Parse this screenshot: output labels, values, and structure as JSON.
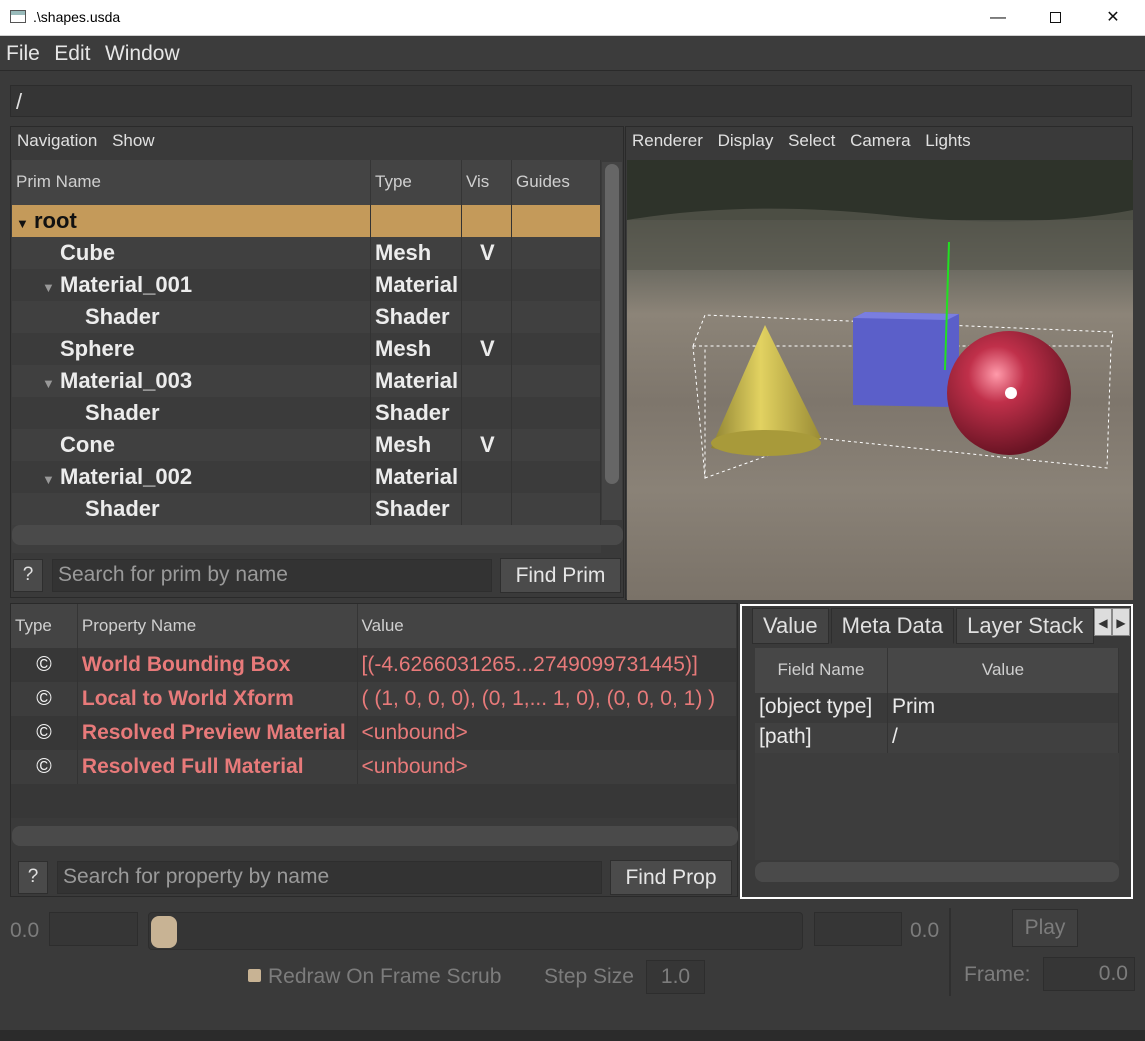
{
  "window": {
    "title": ".\\shapes.usda",
    "minimize": "—",
    "close": "✕"
  },
  "menu": [
    "File",
    "Edit",
    "Window"
  ],
  "path": "/",
  "navigation": {
    "menu": [
      "Navigation",
      "Show"
    ],
    "columns": [
      "Prim Name",
      "Type",
      "Vis",
      "Guides"
    ],
    "rows": [
      {
        "name": "root",
        "type": "",
        "vis": "",
        "depth": 0,
        "expander": "▼",
        "selected": true
      },
      {
        "name": "Cube",
        "type": "Mesh",
        "vis": "V",
        "depth": 1,
        "expander": ""
      },
      {
        "name": "Material_001",
        "type": "Material",
        "vis": "",
        "depth": 1,
        "expander": "▼"
      },
      {
        "name": "Shader",
        "type": "Shader",
        "vis": "",
        "depth": 2,
        "expander": ""
      },
      {
        "name": "Sphere",
        "type": "Mesh",
        "vis": "V",
        "depth": 1,
        "expander": ""
      },
      {
        "name": "Material_003",
        "type": "Material",
        "vis": "",
        "depth": 1,
        "expander": "▼"
      },
      {
        "name": "Shader",
        "type": "Shader",
        "vis": "",
        "depth": 2,
        "expander": ""
      },
      {
        "name": "Cone",
        "type": "Mesh",
        "vis": "V",
        "depth": 1,
        "expander": ""
      },
      {
        "name": "Material_002",
        "type": "Material",
        "vis": "",
        "depth": 1,
        "expander": "▼"
      },
      {
        "name": "Shader",
        "type": "Shader",
        "vis": "",
        "depth": 2,
        "expander": ""
      }
    ],
    "help": "?",
    "search_placeholder": "Search for prim by name",
    "find_label": "Find Prim"
  },
  "viewport": {
    "menu": [
      "Renderer",
      "Display",
      "Select",
      "Camera",
      "Lights"
    ],
    "colors": {
      "cone": "#d4c34e",
      "cube": "#5b5fc9",
      "sphere": "#c0304a",
      "axis": "#22e022"
    }
  },
  "properties": {
    "columns": [
      "Type",
      "Property Name",
      "Value"
    ],
    "rows": [
      {
        "type": "©",
        "name": "World Bounding Box",
        "value": "[(-4.6266031265...2749099731445)]"
      },
      {
        "type": "©",
        "name": "Local to World Xform",
        "value": "( (1, 0, 0, 0), (0, 1,... 1, 0), (0, 0, 0, 1) )"
      },
      {
        "type": "©",
        "name": "Resolved Preview Material",
        "value": "<unbound>"
      },
      {
        "type": "©",
        "name": "Resolved Full Material",
        "value": "<unbound>"
      }
    ],
    "help": "?",
    "search_placeholder": "Search for property by name",
    "find_label": "Find Prop",
    "name_color": "#e87a7a"
  },
  "metadata": {
    "tabs": [
      "Value",
      "Meta Data",
      "Layer Stack"
    ],
    "active_tab": "Meta Data",
    "columns": [
      "Field Name",
      "Value"
    ],
    "rows": [
      {
        "field": "[object type]",
        "value": "Prim"
      },
      {
        "field": "[path]",
        "value": "/"
      }
    ]
  },
  "timeline": {
    "start_label": "0.0",
    "end_label": "0.0",
    "redraw_label": "Redraw On Frame Scrub",
    "step_size_label": "Step Size",
    "step_size_value": "1.0",
    "play_label": "Play",
    "frame_label": "Frame:",
    "frame_value": "0.0",
    "accent": "#c8b394"
  }
}
